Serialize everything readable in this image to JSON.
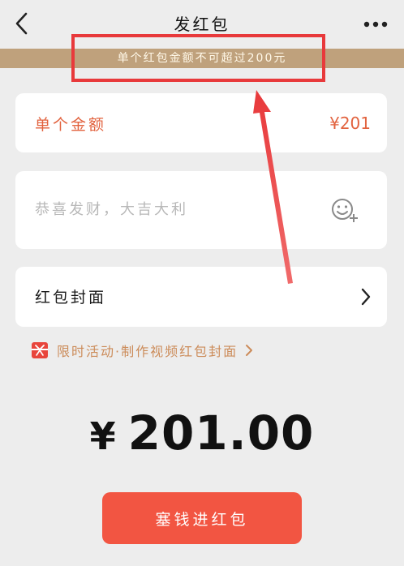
{
  "navbar": {
    "back_icon": "chevron-left-icon",
    "title": "发红包",
    "more_icon": "more-dots-icon"
  },
  "warning": {
    "text": "单个红包金额不可超过200元",
    "color": "#bfa17c"
  },
  "annotation": {
    "highlight_color": "#e8393b"
  },
  "amount_card": {
    "label": "单个金额",
    "value": "¥201",
    "text_color": "#e2633f"
  },
  "greeting_card": {
    "placeholder": "恭喜发财，大吉大利",
    "value": "",
    "emoji_icon": "emoji-plus-icon"
  },
  "cover_card": {
    "label": "红包封面",
    "chevron_icon": "chevron-right-icon"
  },
  "promo": {
    "icon": "gift-icon",
    "text": "限时活动·制作视频红包封面",
    "chevron_icon": "chevron-right-icon"
  },
  "total": {
    "currency": "¥",
    "amount": "201.00"
  },
  "submit": {
    "label": "塞钱进红包",
    "color": "#f25542"
  }
}
